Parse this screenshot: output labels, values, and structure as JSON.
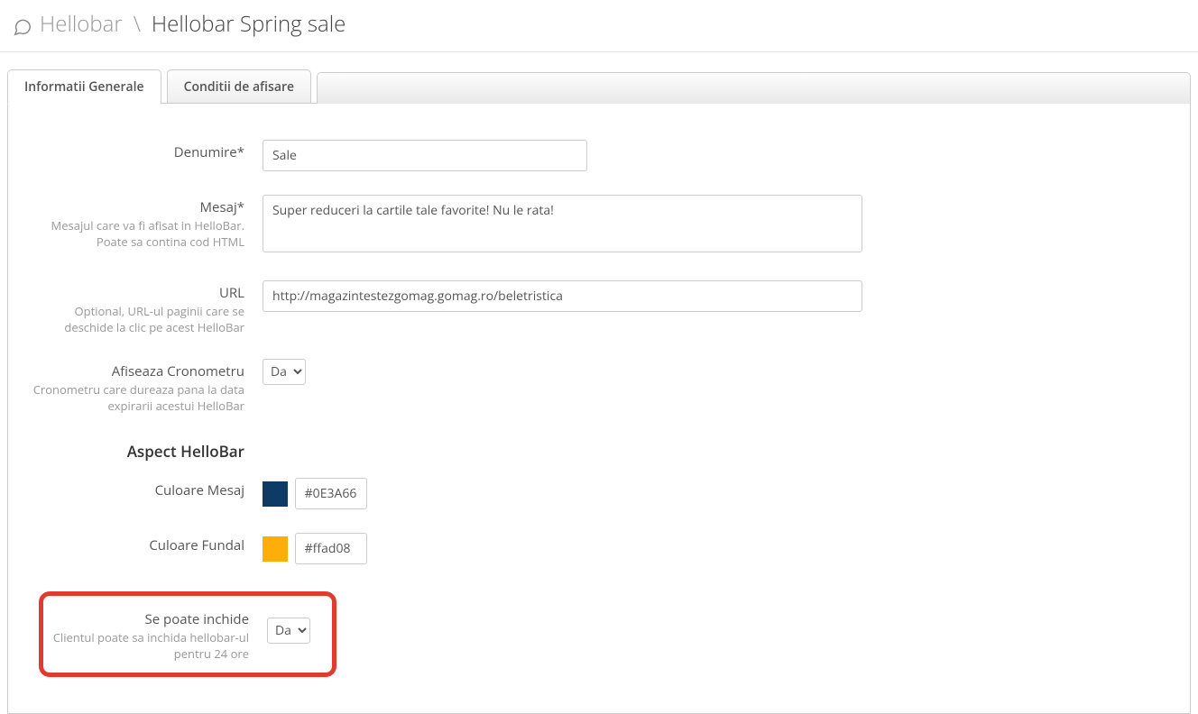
{
  "header": {
    "breadcrumb_parent": "Hellobar",
    "breadcrumb_sep": "\\",
    "breadcrumb_current": "Hellobar Spring sale"
  },
  "tabs": {
    "general": "Informatii Generale",
    "conditions": "Conditii de afisare"
  },
  "fields": {
    "name": {
      "label": "Denumire*",
      "value": "Sale"
    },
    "message": {
      "label": "Mesaj*",
      "help": "Mesajul care va fi afisat in HelloBar. Poate sa contina cod HTML",
      "value": "Super reduceri la cartile tale favorite! Nu le rata!"
    },
    "url": {
      "label": "URL",
      "help": "Optional, URL-ul paginii care se deschide la clic pe acest HelloBar",
      "value": "http://magazintestezgomag.gomag.ro/beletristica"
    },
    "countdown": {
      "label": "Afiseaza Cronometru",
      "help": "Cronometru care dureaza pana la data expirarii acestui HelloBar",
      "value": "Da"
    },
    "closable": {
      "label": "Se poate inchide",
      "help": "Clientul poate sa inchida hellobar-ul pentru 24 ore",
      "value": "Da"
    }
  },
  "aspect": {
    "heading": "Aspect HelloBar",
    "text_color": {
      "label": "Culoare Mesaj",
      "value": "#0E3A66"
    },
    "bg_color": {
      "label": "Culoare Fundal",
      "value": "#ffad08"
    }
  }
}
